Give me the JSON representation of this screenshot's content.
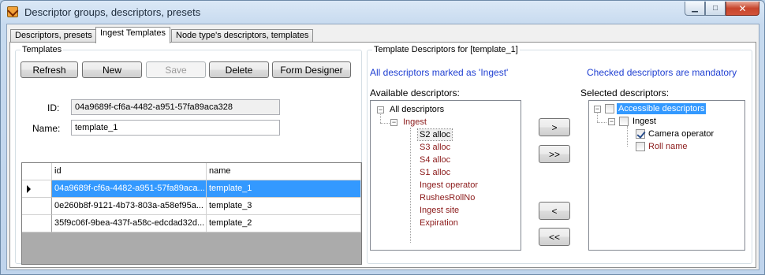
{
  "window": {
    "title": "Descriptor groups, descriptors, presets"
  },
  "tabs": [
    {
      "label": "Descriptors, presets",
      "active": false
    },
    {
      "label": "Ingest Templates",
      "active": true
    },
    {
      "label": "Node type's descriptors, templates",
      "active": false
    }
  ],
  "templates": {
    "group_title": "Templates",
    "buttons": {
      "refresh": "Refresh",
      "new": "New",
      "save": "Save",
      "delete": "Delete",
      "form_designer": "Form Designer"
    },
    "id_label": "ID:",
    "id_value": "04a9689f-cf6a-4482-a951-57fa89aca328",
    "name_label": "Name:",
    "name_value": "template_1",
    "grid": {
      "columns": [
        "id",
        "name"
      ],
      "rows": [
        {
          "id": "04a9689f-cf6a-4482-a951-57fa89aca...",
          "name": "template_1",
          "selected": true
        },
        {
          "id": "0e260b8f-9121-4b73-803a-a58ef95a...",
          "name": "template_3",
          "selected": false
        },
        {
          "id": "35f9c06f-9bea-437f-a58c-edcdad32d...",
          "name": "template_2",
          "selected": false
        }
      ]
    }
  },
  "template_descriptors": {
    "group_title": "Template Descriptors for [template_1]",
    "note_ingest": "All descriptors marked as 'Ingest'",
    "note_mandatory": "Checked descriptors are mandatory",
    "available_label": "Available descriptors:",
    "selected_label": "Selected descriptors:",
    "available": {
      "root": "All descriptors",
      "group": "Ingest",
      "items": [
        "S2 alloc",
        "S3 alloc",
        "S4 alloc",
        "S1 alloc",
        "Ingest operator",
        "RushesRollNo",
        "Ingest site",
        "Expiration"
      ]
    },
    "selected": {
      "root": "Accessible descriptors",
      "group": "Ingest",
      "items": [
        {
          "label": "Camera operator",
          "checked": true
        },
        {
          "label": "Roll name",
          "checked": false
        }
      ]
    },
    "buttons": {
      "add": ">",
      "add_all": ">>",
      "remove": "<",
      "remove_all": "<<"
    }
  }
}
